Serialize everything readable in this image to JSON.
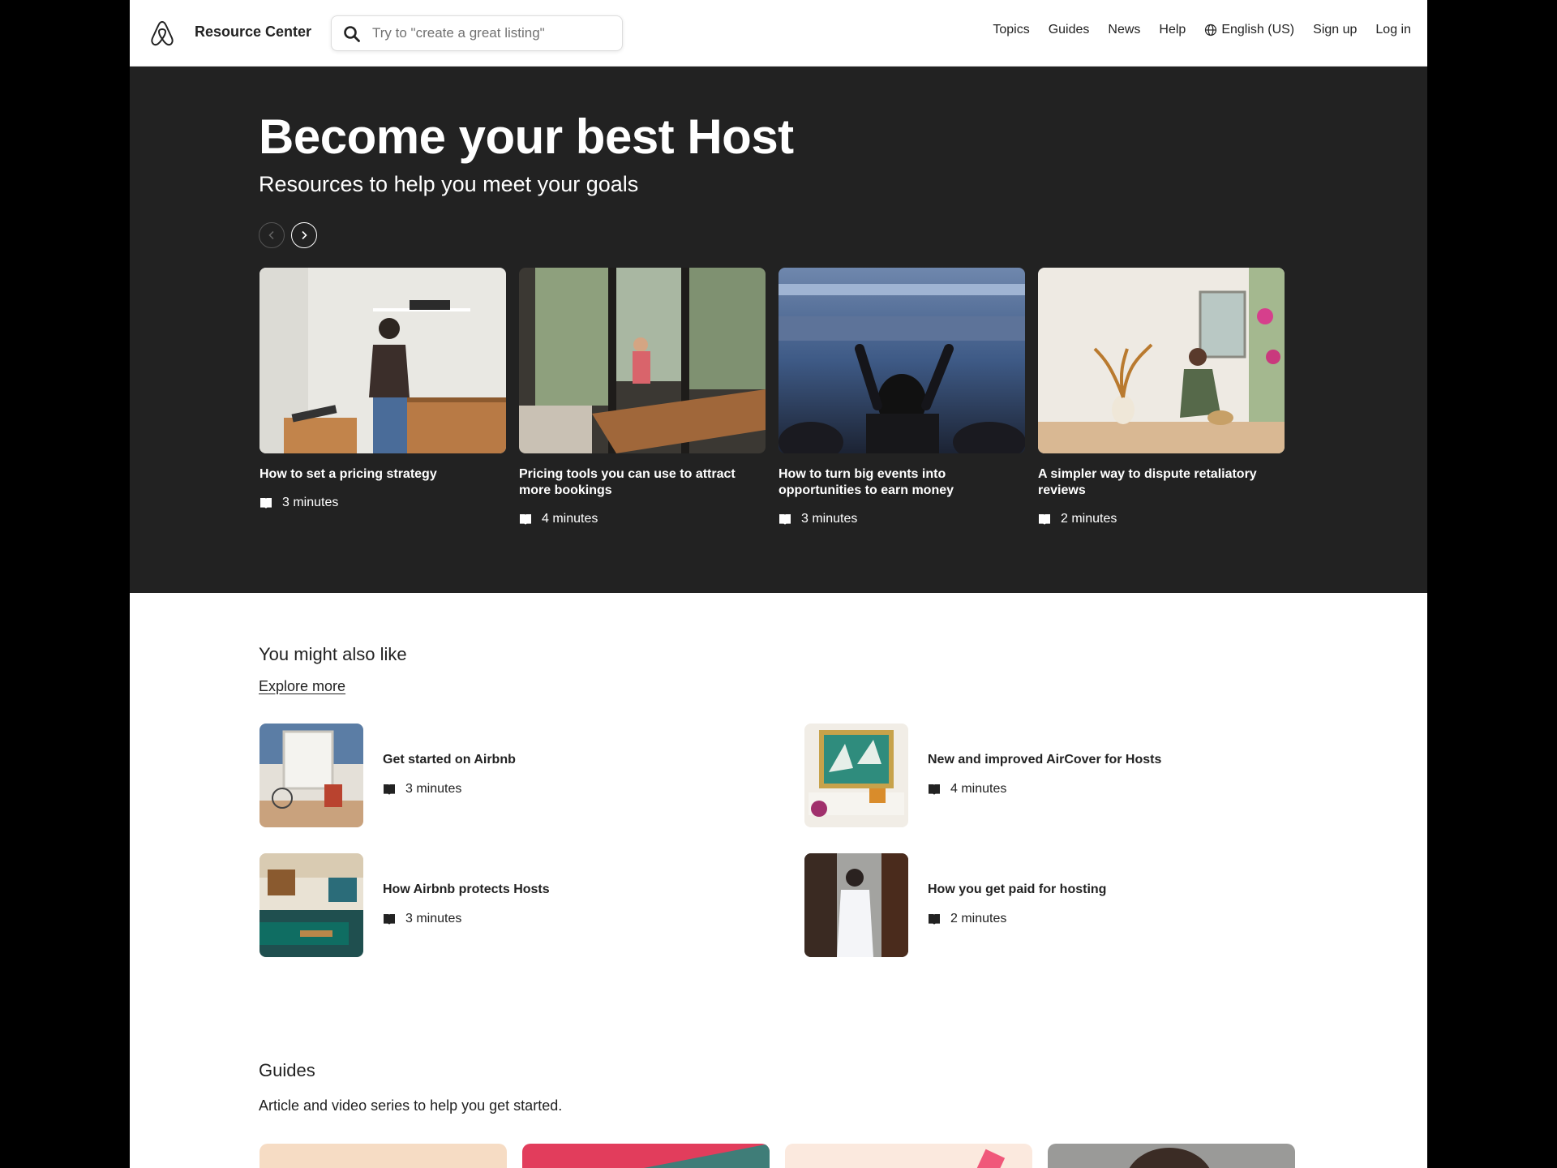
{
  "header": {
    "brand": "Resource Center",
    "search_placeholder": "Try to \"create a great listing\"",
    "nav": [
      "Topics",
      "Guides",
      "News",
      "Help",
      "English (US)",
      "Sign up",
      "Log in"
    ]
  },
  "hero": {
    "title": "Become your best Host",
    "subtitle": "Resources to help you meet your goals",
    "cards": [
      {
        "title": "How to set a pricing strategy",
        "time": "3 minutes"
      },
      {
        "title": "Pricing tools you can use to attract more bookings",
        "time": "4 minutes"
      },
      {
        "title": "How to turn big events into opportunities to earn money",
        "time": "3 minutes"
      },
      {
        "title": "A simpler way to dispute retaliatory reviews",
        "time": "2 minutes"
      }
    ]
  },
  "also": {
    "title": "You might also like",
    "explore": "Explore more",
    "items": [
      {
        "title": "Get started on Airbnb",
        "time": "3 minutes"
      },
      {
        "title": "New and improved AirCover for Hosts",
        "time": "4 minutes"
      },
      {
        "title": "How Airbnb protects Hosts",
        "time": "3 minutes"
      },
      {
        "title": "How you get paid for hosting",
        "time": "2 minutes"
      }
    ]
  },
  "guides": {
    "title": "Guides",
    "subtitle": "Article and video series to help you get started."
  },
  "colors": {
    "hero_bg": "#222222",
    "outer_bg": "#000000"
  }
}
